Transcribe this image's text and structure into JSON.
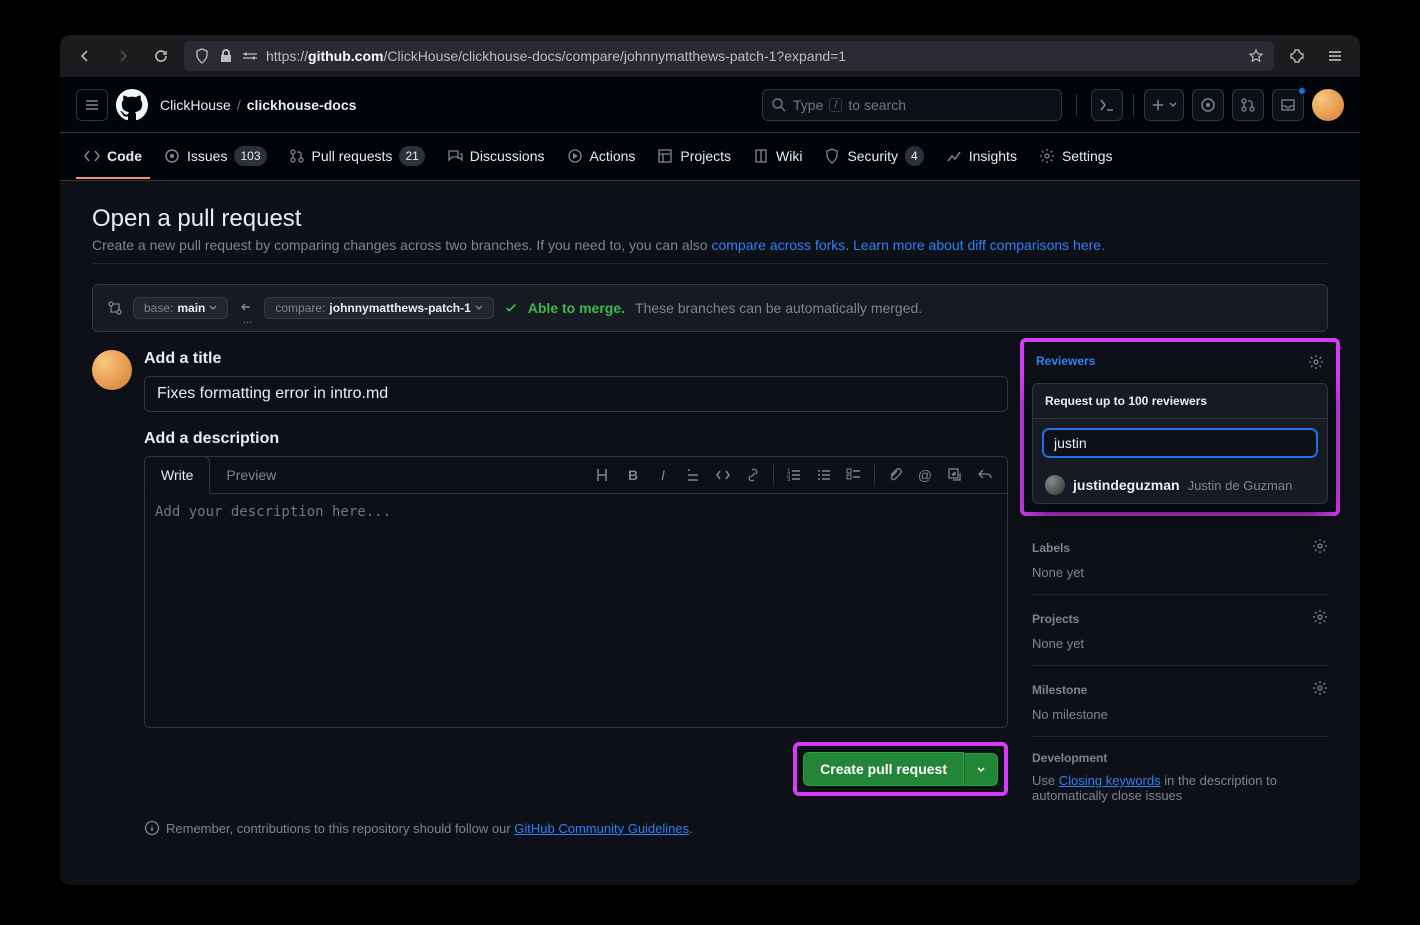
{
  "url": {
    "scheme": "https://",
    "host": "github.com",
    "path": "/ClickHouse/clickhouse-docs/compare/johnnymatthews-patch-1?expand=1"
  },
  "breadcrumb": {
    "owner": "ClickHouse",
    "repo": "clickhouse-docs"
  },
  "search": {
    "prefix": "Type",
    "suffix": "to search",
    "kbd": "/"
  },
  "tabs": [
    {
      "label": "Code",
      "active": true,
      "count": null
    },
    {
      "label": "Issues",
      "count": "103"
    },
    {
      "label": "Pull requests",
      "count": "21"
    },
    {
      "label": "Discussions",
      "count": null
    },
    {
      "label": "Actions",
      "count": null
    },
    {
      "label": "Projects",
      "count": null
    },
    {
      "label": "Wiki",
      "count": null
    },
    {
      "label": "Security",
      "count": "4"
    },
    {
      "label": "Insights",
      "count": null
    },
    {
      "label": "Settings",
      "count": null
    }
  ],
  "page": {
    "heading": "Open a pull request",
    "sub1": "Create a new pull request by comparing changes across two branches. If you need to, you can also ",
    "link1": "compare across forks",
    "dot": ". ",
    "link2": "Learn more about diff comparisons here."
  },
  "compare": {
    "base_label": "base:",
    "base_val": "main",
    "cmp_label": "compare:",
    "cmp_val": "johnnymatthews-patch-1",
    "merge_ok": "Able to merge.",
    "merge_txt": "These branches can be automatically merged.",
    "ellipsis": "…"
  },
  "form": {
    "title_label": "Add a title",
    "title_value": "Fixes formatting error in intro.md",
    "desc_label": "Add a description",
    "write": "Write",
    "preview": "Preview",
    "placeholder": "Add your description here...",
    "submit": "Create pull request"
  },
  "footer": {
    "text": "Remember, contributions to this repository should follow our ",
    "link": "GitHub Community Guidelines",
    "dot": "."
  },
  "sidebar": {
    "reviewers": {
      "label": "Reviewers",
      "prompt": "Request up to 100 reviewers",
      "search": "justin",
      "result_user": "justindeguzman",
      "result_name": "Justin de Guzman"
    },
    "labels": {
      "title": "Labels",
      "body": "None yet"
    },
    "projects": {
      "title": "Projects",
      "body": "None yet"
    },
    "milestone": {
      "title": "Milestone",
      "body": "No milestone"
    },
    "dev": {
      "title": "Development",
      "t1": "Use ",
      "link": "Closing keywords",
      "t2": " in the description to automatically close issues"
    }
  }
}
